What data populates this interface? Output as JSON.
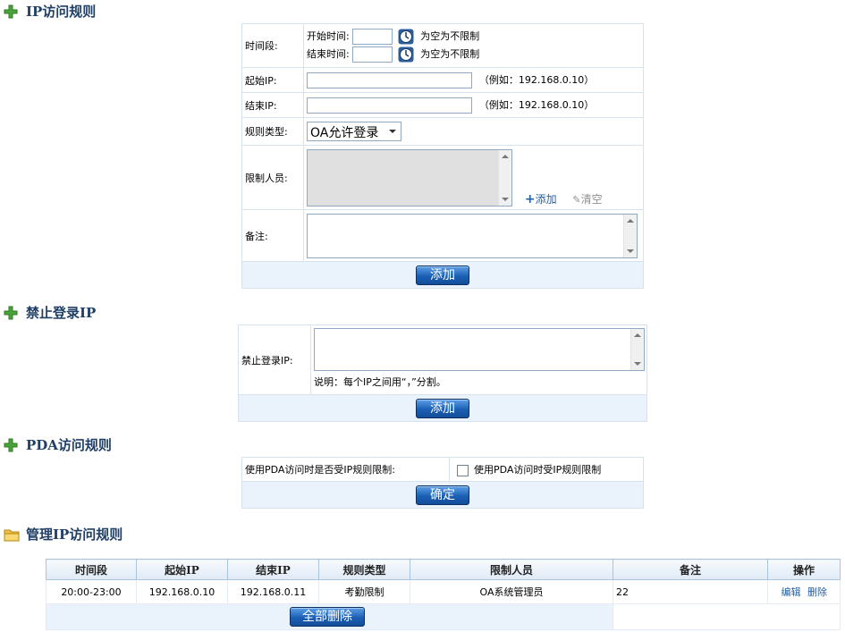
{
  "sections": {
    "ip_rule": "IP访问规则",
    "forbid_ip": "禁止登录IP",
    "pda_rule": "PDA访问规则",
    "manage_rule": "管理IP访问规则"
  },
  "ip_form": {
    "time_label": "时间段:",
    "start_time_label": "开始时间:",
    "end_time_label": "结束时间:",
    "start_time_value": "",
    "end_time_value": "",
    "no_limit_hint": "为空为不限制",
    "start_ip_label": "起始IP:",
    "end_ip_label": "结束IP:",
    "ip_example": "（例如：192.168.0.10）",
    "rule_type_label": "规则类型:",
    "rule_type_value": "OA允许登录",
    "limit_user_label": "限制人员:",
    "add_link": "添加",
    "clear_link": "清空",
    "note_label": "备注:",
    "add_button": "添加"
  },
  "forbid_form": {
    "label": "禁止登录IP:",
    "desc": "说明：每个IP之间用“，”分割。",
    "add_button": "添加"
  },
  "pda_form": {
    "question": "使用PDA访问时是否受IP规则限制:",
    "checkbox_label": "使用PDA访问时受IP规则限制",
    "checked": false,
    "ok_button": "确定"
  },
  "manage_table": {
    "headers": [
      "时间段",
      "起始IP",
      "结束IP",
      "规则类型",
      "限制人员",
      "备注",
      "操作"
    ],
    "rows": [
      {
        "time": "20:00-23:00",
        "start_ip": "192.168.0.10",
        "end_ip": "192.168.0.11",
        "type": "考勤限制",
        "users": "OA系统管理员",
        "note": "22",
        "edit": "编辑",
        "delete": "删除"
      }
    ],
    "delete_all_button": "全部删除"
  }
}
